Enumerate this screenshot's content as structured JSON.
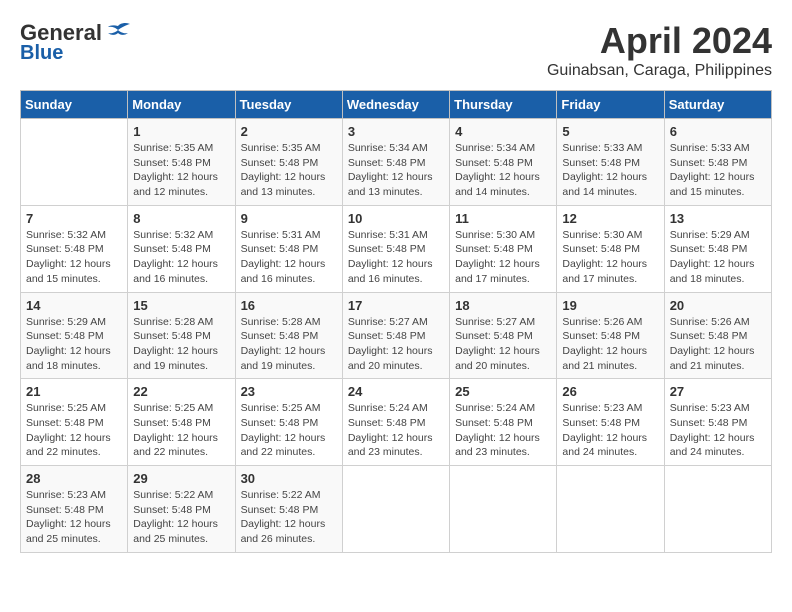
{
  "header": {
    "logo_general": "General",
    "logo_blue": "Blue",
    "month_title": "April 2024",
    "location": "Guinabsan, Caraga, Philippines"
  },
  "calendar": {
    "days_of_week": [
      "Sunday",
      "Monday",
      "Tuesday",
      "Wednesday",
      "Thursday",
      "Friday",
      "Saturday"
    ],
    "weeks": [
      [
        {
          "day": "",
          "detail": ""
        },
        {
          "day": "1",
          "detail": "Sunrise: 5:35 AM\nSunset: 5:48 PM\nDaylight: 12 hours\nand 12 minutes."
        },
        {
          "day": "2",
          "detail": "Sunrise: 5:35 AM\nSunset: 5:48 PM\nDaylight: 12 hours\nand 13 minutes."
        },
        {
          "day": "3",
          "detail": "Sunrise: 5:34 AM\nSunset: 5:48 PM\nDaylight: 12 hours\nand 13 minutes."
        },
        {
          "day": "4",
          "detail": "Sunrise: 5:34 AM\nSunset: 5:48 PM\nDaylight: 12 hours\nand 14 minutes."
        },
        {
          "day": "5",
          "detail": "Sunrise: 5:33 AM\nSunset: 5:48 PM\nDaylight: 12 hours\nand 14 minutes."
        },
        {
          "day": "6",
          "detail": "Sunrise: 5:33 AM\nSunset: 5:48 PM\nDaylight: 12 hours\nand 15 minutes."
        }
      ],
      [
        {
          "day": "7",
          "detail": "Sunrise: 5:32 AM\nSunset: 5:48 PM\nDaylight: 12 hours\nand 15 minutes."
        },
        {
          "day": "8",
          "detail": "Sunrise: 5:32 AM\nSunset: 5:48 PM\nDaylight: 12 hours\nand 16 minutes."
        },
        {
          "day": "9",
          "detail": "Sunrise: 5:31 AM\nSunset: 5:48 PM\nDaylight: 12 hours\nand 16 minutes."
        },
        {
          "day": "10",
          "detail": "Sunrise: 5:31 AM\nSunset: 5:48 PM\nDaylight: 12 hours\nand 16 minutes."
        },
        {
          "day": "11",
          "detail": "Sunrise: 5:30 AM\nSunset: 5:48 PM\nDaylight: 12 hours\nand 17 minutes."
        },
        {
          "day": "12",
          "detail": "Sunrise: 5:30 AM\nSunset: 5:48 PM\nDaylight: 12 hours\nand 17 minutes."
        },
        {
          "day": "13",
          "detail": "Sunrise: 5:29 AM\nSunset: 5:48 PM\nDaylight: 12 hours\nand 18 minutes."
        }
      ],
      [
        {
          "day": "14",
          "detail": "Sunrise: 5:29 AM\nSunset: 5:48 PM\nDaylight: 12 hours\nand 18 minutes."
        },
        {
          "day": "15",
          "detail": "Sunrise: 5:28 AM\nSunset: 5:48 PM\nDaylight: 12 hours\nand 19 minutes."
        },
        {
          "day": "16",
          "detail": "Sunrise: 5:28 AM\nSunset: 5:48 PM\nDaylight: 12 hours\nand 19 minutes."
        },
        {
          "day": "17",
          "detail": "Sunrise: 5:27 AM\nSunset: 5:48 PM\nDaylight: 12 hours\nand 20 minutes."
        },
        {
          "day": "18",
          "detail": "Sunrise: 5:27 AM\nSunset: 5:48 PM\nDaylight: 12 hours\nand 20 minutes."
        },
        {
          "day": "19",
          "detail": "Sunrise: 5:26 AM\nSunset: 5:48 PM\nDaylight: 12 hours\nand 21 minutes."
        },
        {
          "day": "20",
          "detail": "Sunrise: 5:26 AM\nSunset: 5:48 PM\nDaylight: 12 hours\nand 21 minutes."
        }
      ],
      [
        {
          "day": "21",
          "detail": "Sunrise: 5:25 AM\nSunset: 5:48 PM\nDaylight: 12 hours\nand 22 minutes."
        },
        {
          "day": "22",
          "detail": "Sunrise: 5:25 AM\nSunset: 5:48 PM\nDaylight: 12 hours\nand 22 minutes."
        },
        {
          "day": "23",
          "detail": "Sunrise: 5:25 AM\nSunset: 5:48 PM\nDaylight: 12 hours\nand 22 minutes."
        },
        {
          "day": "24",
          "detail": "Sunrise: 5:24 AM\nSunset: 5:48 PM\nDaylight: 12 hours\nand 23 minutes."
        },
        {
          "day": "25",
          "detail": "Sunrise: 5:24 AM\nSunset: 5:48 PM\nDaylight: 12 hours\nand 23 minutes."
        },
        {
          "day": "26",
          "detail": "Sunrise: 5:23 AM\nSunset: 5:48 PM\nDaylight: 12 hours\nand 24 minutes."
        },
        {
          "day": "27",
          "detail": "Sunrise: 5:23 AM\nSunset: 5:48 PM\nDaylight: 12 hours\nand 24 minutes."
        }
      ],
      [
        {
          "day": "28",
          "detail": "Sunrise: 5:23 AM\nSunset: 5:48 PM\nDaylight: 12 hours\nand 25 minutes."
        },
        {
          "day": "29",
          "detail": "Sunrise: 5:22 AM\nSunset: 5:48 PM\nDaylight: 12 hours\nand 25 minutes."
        },
        {
          "day": "30",
          "detail": "Sunrise: 5:22 AM\nSunset: 5:48 PM\nDaylight: 12 hours\nand 26 minutes."
        },
        {
          "day": "",
          "detail": ""
        },
        {
          "day": "",
          "detail": ""
        },
        {
          "day": "",
          "detail": ""
        },
        {
          "day": "",
          "detail": ""
        }
      ]
    ]
  }
}
